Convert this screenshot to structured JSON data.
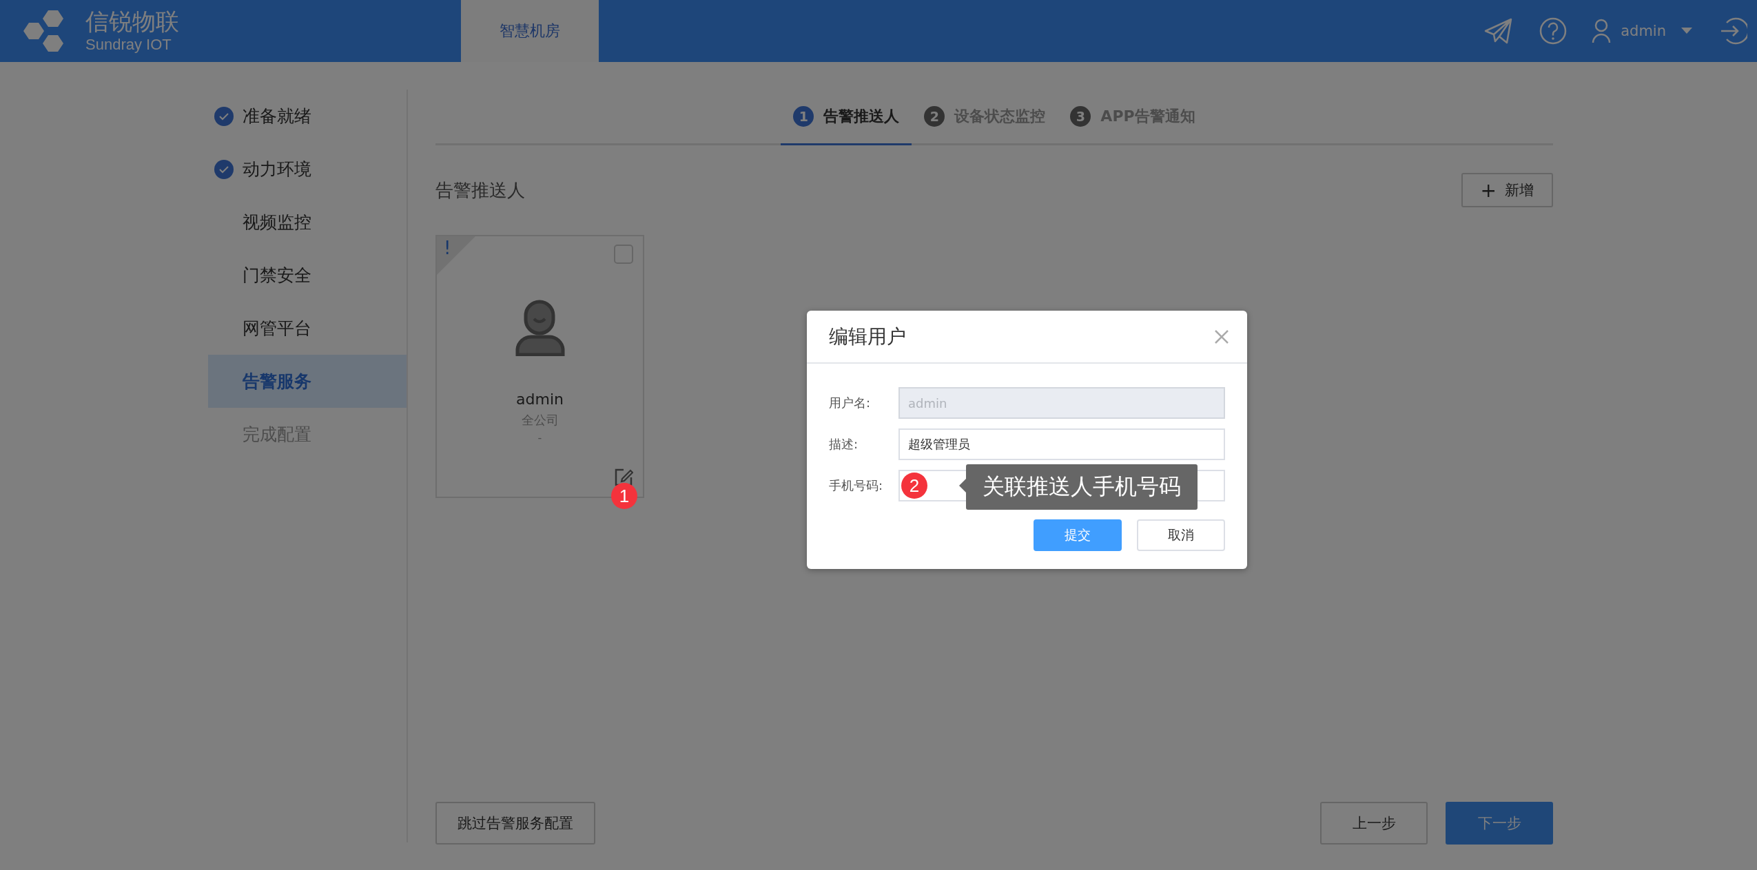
{
  "header": {
    "logo": {
      "name": "信锐物联",
      "subtitle": "Sundray IOT"
    },
    "nav_tabs": [
      {
        "label": "智慧机房",
        "selected": true
      }
    ],
    "user": {
      "name": "admin"
    }
  },
  "sidebar": {
    "items": [
      {
        "label": "准备就绪",
        "done": true,
        "selected": false,
        "disabled": false
      },
      {
        "label": "动力环境",
        "done": true,
        "selected": false,
        "disabled": false
      },
      {
        "label": "视频监控",
        "done": false,
        "selected": false,
        "disabled": false
      },
      {
        "label": "门禁安全",
        "done": false,
        "selected": false,
        "disabled": false
      },
      {
        "label": "网管平台",
        "done": false,
        "selected": false,
        "disabled": false
      },
      {
        "label": "告警服务",
        "done": false,
        "selected": true,
        "disabled": false
      },
      {
        "label": "完成配置",
        "done": false,
        "selected": false,
        "disabled": true
      }
    ]
  },
  "steps": [
    {
      "number": "1",
      "label": "告警推送人",
      "selected": true
    },
    {
      "number": "2",
      "label": "设备状态监控",
      "selected": false
    },
    {
      "number": "3",
      "label": "APP告警通知",
      "selected": false
    }
  ],
  "section_title": "告警推送人",
  "add_button": {
    "icon": "+",
    "label": "新增"
  },
  "cards": [
    {
      "flag": "!",
      "name": "admin",
      "org": "全公司",
      "phone": "-",
      "checked": false
    }
  ],
  "dialog": {
    "title": "编辑用户",
    "fields": [
      {
        "label": "用户名:",
        "value": "admin",
        "disabled": true
      },
      {
        "label": "描述:",
        "value": "超级管理员",
        "disabled": false
      },
      {
        "label": "手机号码:",
        "disabled": false
      }
    ],
    "buttons": [
      {
        "label": "提交",
        "kind": "primary"
      },
      {
        "label": "取消",
        "kind": "default"
      }
    ]
  },
  "annotations": [
    {
      "number": "1"
    },
    {
      "number": "2",
      "text": "关联推送人手机号码"
    }
  ],
  "footer": {
    "skip_button": "跳过告警服务配置",
    "prev_button": "上一步",
    "next_button": "下一步"
  }
}
